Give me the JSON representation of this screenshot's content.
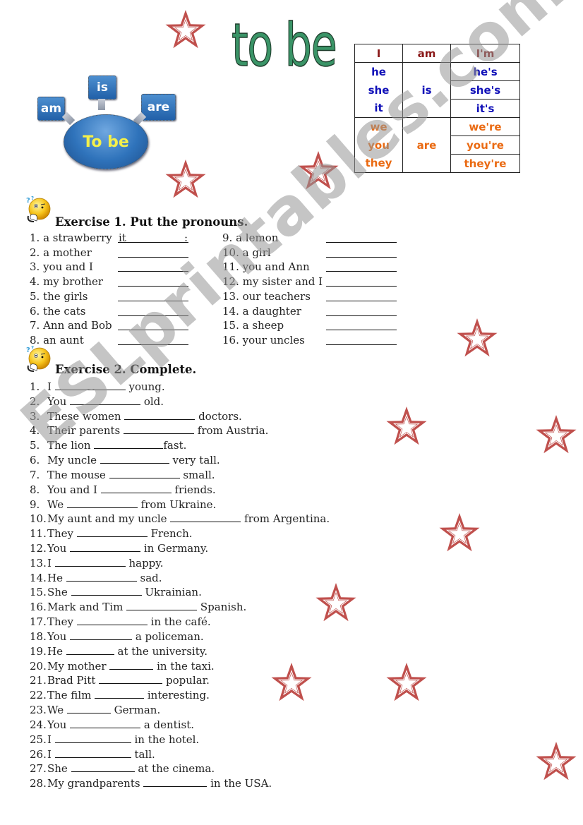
{
  "title": "to be",
  "diagram": {
    "center": "To be",
    "forms": [
      "am",
      "is",
      "are"
    ]
  },
  "conjugation_table": {
    "rows": [
      {
        "pronouns": [
          "I"
        ],
        "verb": "am",
        "contractions": [
          "I'm"
        ],
        "color": "#8b1a1a"
      },
      {
        "pronouns": [
          "he",
          "she",
          "it"
        ],
        "verb": "is",
        "contractions": [
          "he's",
          "she's",
          "it's"
        ],
        "color": "#1010b8"
      },
      {
        "pronouns": [
          "we",
          "you",
          "they"
        ],
        "verb": "are",
        "contractions": [
          "we're",
          "you're",
          "they're"
        ],
        "color": "#ea6a12"
      }
    ]
  },
  "exercise1": {
    "heading": "Exercise 1. Put the pronouns.",
    "example_answer": "it",
    "example_suffix": ":",
    "left": [
      "1. a strawberry",
      "2. a mother",
      "3. you and I",
      "4. my brother",
      "5. the girls",
      "6. the cats",
      "7. Ann and Bob",
      "8. an aunt"
    ],
    "right": [
      "9. a lemon",
      "10. a girl",
      "11. you and Ann",
      "12. my sister and I",
      "13. our teachers",
      "14. a daughter",
      "15. a sheep",
      "16. your uncles"
    ]
  },
  "exercise2": {
    "heading": "Exercise 2. Complete.",
    "items": [
      {
        "num": "1.",
        "before": "I",
        "after": "young."
      },
      {
        "num": "2.",
        "before": "You",
        "after": "old."
      },
      {
        "num": "3.",
        "before": "These women",
        "after": "doctors."
      },
      {
        "num": "4.",
        "before": "Their parents",
        "after": "from Austria."
      },
      {
        "num": "5.",
        "before": "The lion",
        "after": "fast."
      },
      {
        "num": "6.",
        "before": "My uncle",
        "after": "very tall."
      },
      {
        "num": "7.",
        "before": "The mouse",
        "after": "small."
      },
      {
        "num": "8.",
        "before": "You and I",
        "after": "friends."
      },
      {
        "num": "9.",
        "before": "We",
        "after": "from Ukraine."
      },
      {
        "num": "10.",
        "before": "My aunt and my uncle",
        "after": "from Argentina."
      },
      {
        "num": "11.",
        "before": "They",
        "after": "French."
      },
      {
        "num": "12.",
        "before": "You",
        "after": "in Germany."
      },
      {
        "num": "13.",
        "before": "I",
        "after": "happy."
      },
      {
        "num": "14.",
        "before": "He",
        "after": "sad."
      },
      {
        "num": "15.",
        "before": "She",
        "after": "Ukrainian."
      },
      {
        "num": "16.",
        "before": "Mark and Tim",
        "after": "Spanish."
      },
      {
        "num": "17.",
        "before": "They",
        "after": "in the café."
      },
      {
        "num": "18.",
        "before": "You",
        "after": "a policeman."
      },
      {
        "num": "19.",
        "before": "He",
        "after": "at the university."
      },
      {
        "num": "20.",
        "before": "My mother",
        "after": "in the taxi."
      },
      {
        "num": "21.",
        "before": "Brad Pitt",
        "after": "popular."
      },
      {
        "num": "22.",
        "before": "The film",
        "after": "interesting."
      },
      {
        "num": "23.",
        "before": "We",
        "after": "German."
      },
      {
        "num": "24.",
        "before": "You",
        "after": "a dentist."
      },
      {
        "num": "25.",
        "before": "I",
        "after": "in the hotel."
      },
      {
        "num": "26.",
        "before": "I",
        "after": "tall."
      },
      {
        "num": "27.",
        "before": "She",
        "after": "at the cinema."
      },
      {
        "num": "28.",
        "before": "My grandparents",
        "after": "in the USA."
      }
    ]
  },
  "watermark": "ESLprintables.com",
  "icons": {
    "star": "star-icon",
    "thinking_face": "thinking-smiley-icon"
  },
  "colors": {
    "title_green": "#3a9467",
    "star_red": "#c0504d",
    "diagram_blue": "#2f73bb",
    "diagram_text_yellow": "#f4f04a",
    "pronoun_I": "#8b1a1a",
    "pronoun_singular": "#1010b8",
    "pronoun_plural": "#ea6a12"
  }
}
